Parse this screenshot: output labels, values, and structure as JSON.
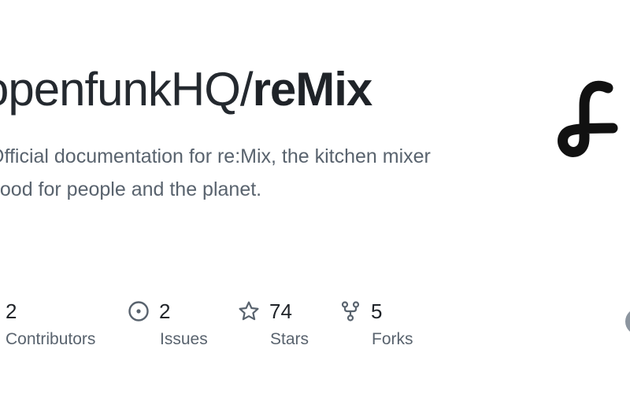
{
  "repo": {
    "owner_prefix": "openfunkHQ/",
    "name": "reMix",
    "description_line1": "Official documentation for re:Mix, the kitchen mixer",
    "description_line2": "good for people and the planet."
  },
  "stats": {
    "contributors": {
      "count": "2",
      "label": "Contributors",
      "icon": "people-icon"
    },
    "issues": {
      "count": "2",
      "label": "Issues",
      "icon": "issue-opened-icon"
    },
    "stars": {
      "count": "74",
      "label": "Stars",
      "icon": "star-icon"
    },
    "forks": {
      "count": "5",
      "label": "Forks",
      "icon": "repo-forked-icon"
    }
  },
  "colors": {
    "text": "#1f2328",
    "muted": "#59636e",
    "icon": "#59636e"
  }
}
